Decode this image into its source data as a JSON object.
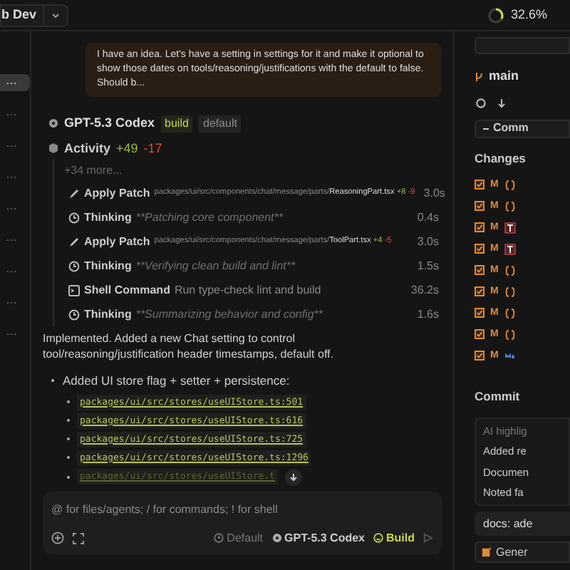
{
  "top_bar": {
    "workspace": "b Dev",
    "progress": "32.6%",
    "level": 0.326
  },
  "sidebar": {
    "items": [
      {
        "label": "…",
        "selected": true
      },
      {
        "label": "…",
        "selected": false
      },
      {
        "label": "…",
        "selected": false
      },
      {
        "label": "…",
        "selected": false
      },
      {
        "label": "…",
        "selected": false
      },
      {
        "label": "…",
        "selected": false
      },
      {
        "label": "…",
        "selected": false
      },
      {
        "label": "…",
        "selected": false
      },
      {
        "label": "…",
        "selected": false
      }
    ]
  },
  "user_message": "I have an idea. Let's have a setting in settings for it and make it optional to show those dates on tools/reasoning/justifications with the default to false. Should b...",
  "assistant": {
    "model": "GPT-5.3 Codex",
    "tags": [
      {
        "label": "build",
        "selected": true
      },
      {
        "label": "default",
        "selected": false
      }
    ],
    "activity": {
      "label": "Activity",
      "added": "+49",
      "removed": "-17",
      "more": "+34 more...",
      "steps": [
        {
          "kind": "patch",
          "title": "Apply Patch",
          "path": "packages/ui/src/components/chat/message/parts/",
          "file": "ReasoningPart.tsx",
          "added": "+8",
          "removed": "-9",
          "time": "3.0s"
        },
        {
          "kind": "thinking",
          "title": "Thinking",
          "detail": "**Patching core component**",
          "time": "0.4s"
        },
        {
          "kind": "patch",
          "title": "Apply Patch",
          "path": "packages/ui/src/components/chat/message/parts/",
          "file": "ToolPart.tsx",
          "added": "+4",
          "removed": "-5",
          "time": "3.0s"
        },
        {
          "kind": "thinking",
          "title": "Thinking",
          "detail": "**Verifying clean build and lint**",
          "time": "1.5s"
        },
        {
          "kind": "shell",
          "title": "Shell Command",
          "detail": "Run type-check lint and build",
          "time": "36.2s"
        },
        {
          "kind": "thinking",
          "title": "Thinking",
          "detail": "**Summarizing behavior and config**",
          "time": "1.6s"
        }
      ]
    },
    "summary": "Implemented. Added a new Chat setting to control tool/reasoning/justification header timestamps, default off.",
    "bullet": "Added UI store flag + setter + persistence:",
    "links": [
      "packages/ui/src/stores/useUIStore.ts:501",
      "packages/ui/src/stores/useUIStore.ts:616",
      "packages/ui/src/stores/useUIStore.ts:725",
      "packages/ui/src/stores/useUIStore.ts:1296",
      "packages/ui/src/stores/useUIStore.t"
    ]
  },
  "composer": {
    "placeholder": "@ for files/agents; / for commands; ! for shell",
    "mode": "Default",
    "model": "GPT-5.3 Codex",
    "agent": "Build"
  },
  "right_panel": {
    "branch": "main",
    "commit_button": "Comm",
    "changes_title": "Changes",
    "changes": [
      {
        "checked": true,
        "status": "M",
        "kind": "code"
      },
      {
        "checked": true,
        "status": "M",
        "kind": "code"
      },
      {
        "checked": true,
        "status": "M",
        "kind": "text"
      },
      {
        "checked": true,
        "status": "M",
        "kind": "text"
      },
      {
        "checked": true,
        "status": "M",
        "kind": "code"
      },
      {
        "checked": true,
        "status": "M",
        "kind": "code"
      },
      {
        "checked": true,
        "status": "M",
        "kind": "code"
      },
      {
        "checked": true,
        "status": "M",
        "kind": "code"
      },
      {
        "checked": true,
        "status": "M",
        "kind": "markdown"
      }
    ],
    "commit_title": "Commit",
    "highlights": [
      "AI highlig",
      "Added re",
      "Documen",
      "Noted fa"
    ],
    "message": "docs: ade",
    "generate": "Gener"
  }
}
